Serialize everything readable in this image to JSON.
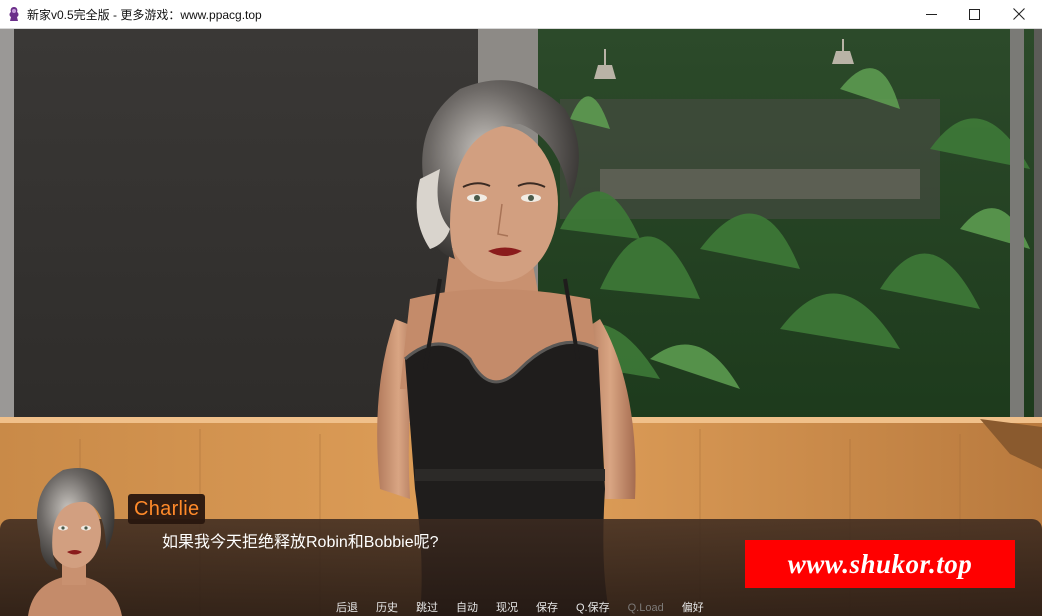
{
  "window": {
    "title": "新家v0.5完全版 - 更多游戏：www.ppacg.top",
    "controls": [
      "minimize",
      "maximize",
      "close"
    ]
  },
  "dialogue": {
    "speaker": "Charlie",
    "text": "如果我今天拒绝释放Robin和Bobbie呢?"
  },
  "watermark": {
    "text": "www.shukor.top"
  },
  "quick_menu": [
    {
      "label": "后退",
      "enabled": true
    },
    {
      "label": "历史",
      "enabled": true
    },
    {
      "label": "跳过",
      "enabled": true
    },
    {
      "label": "自动",
      "enabled": true
    },
    {
      "label": "现况",
      "enabled": true
    },
    {
      "label": "保存",
      "enabled": true
    },
    {
      "label": "Q.保存",
      "enabled": true
    },
    {
      "label": "Q.Load",
      "enabled": false
    },
    {
      "label": "偏好",
      "enabled": true
    }
  ],
  "colors": {
    "speaker_name": "#ff8a2a",
    "watermark_bg": "#ff0000",
    "dialogue_bg": "#3c2a20"
  }
}
